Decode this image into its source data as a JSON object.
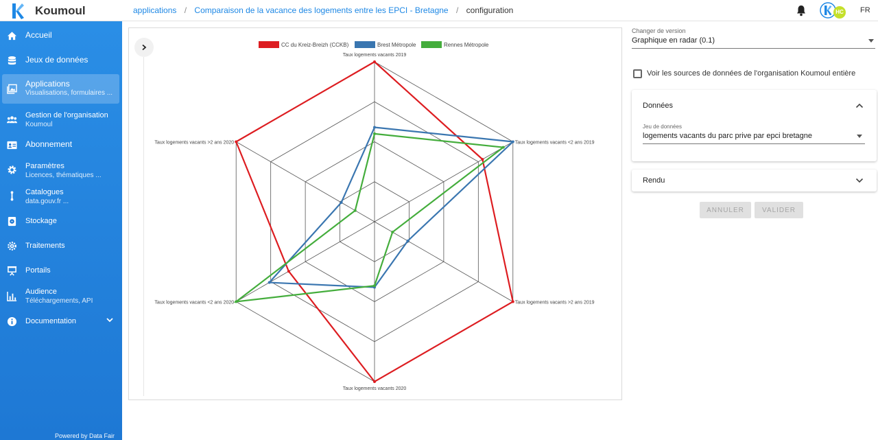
{
  "app": {
    "name": "Koumoul",
    "language": "FR",
    "avatar_initials": "HC"
  },
  "breadcrumbs": [
    {
      "label": "applications"
    },
    {
      "label": "Comparaison de la vacance des logements entre les EPCI - Bretagne"
    },
    {
      "label": "configuration"
    }
  ],
  "sidebar": {
    "items": [
      {
        "label": "Accueil",
        "icon": "home-icon"
      },
      {
        "label": "Jeux de données",
        "icon": "database-icon"
      },
      {
        "label": "Applications",
        "sub": "Visualisations, formulaires ...",
        "icon": "image-icon",
        "active": true
      },
      {
        "label": "Gestion de l'organisation",
        "sub": "Koumoul",
        "icon": "group-icon"
      },
      {
        "label": "Abonnement",
        "icon": "card-icon"
      },
      {
        "label": "Paramètres",
        "sub": "Licences, thématiques ...",
        "icon": "gear-icon"
      },
      {
        "label": "Catalogues",
        "sub": "data.gouv.fr ...",
        "icon": "catalog-icon"
      },
      {
        "label": "Stockage",
        "icon": "storage-icon"
      },
      {
        "label": "Traitements",
        "icon": "cogs-icon"
      },
      {
        "label": "Portails",
        "icon": "presentation-icon"
      },
      {
        "label": "Audience",
        "sub": "Téléchargements, API",
        "icon": "chart-icon"
      },
      {
        "label": "Documentation",
        "icon": "info-icon"
      }
    ],
    "powered_by": "Powered by Data Fair"
  },
  "config": {
    "version_label": "Changer de version",
    "version_value": "Graphique en radar (0.1)",
    "sources_checkbox_label": "Voir les sources de données de l'organisation Koumoul entière",
    "sources_checked": false,
    "panels": {
      "donnees": {
        "title": "Données",
        "dataset_label": "Jeu de données",
        "dataset_value": "logements vacants du parc prive par epci bretagne",
        "expanded": true
      },
      "rendu": {
        "title": "Rendu",
        "expanded": false
      }
    },
    "cancel_label": "ANNULER",
    "validate_label": "VALIDER"
  },
  "chart_data": {
    "type": "radar",
    "axes": [
      "Taux logements vacants 2019",
      "Taux logements vacants <2 ans 2019",
      "Taux logements vacants >2 ans 2019",
      "Taux logements vacants 2020",
      "Taux logements vacants <2 ans 2020",
      "Taux logements vacants >2 ans 2020"
    ],
    "rmax": 1,
    "grid_levels": 4,
    "legend_position": "top-center",
    "series": [
      {
        "name": "CC du Kreiz-Breizh (CCKB)",
        "color": "#dd1d21",
        "values": [
          1.0,
          0.78,
          1.0,
          1.0,
          0.62,
          1.0
        ]
      },
      {
        "name": "Brest Métropole",
        "color": "#3a76b0",
        "values": [
          0.59,
          1.0,
          0.24,
          0.41,
          0.76,
          0.24
        ]
      },
      {
        "name": "Rennes Métropole",
        "color": "#44ad3c",
        "values": [
          0.55,
          0.93,
          0.13,
          0.4,
          1.0,
          0.14
        ]
      }
    ]
  }
}
